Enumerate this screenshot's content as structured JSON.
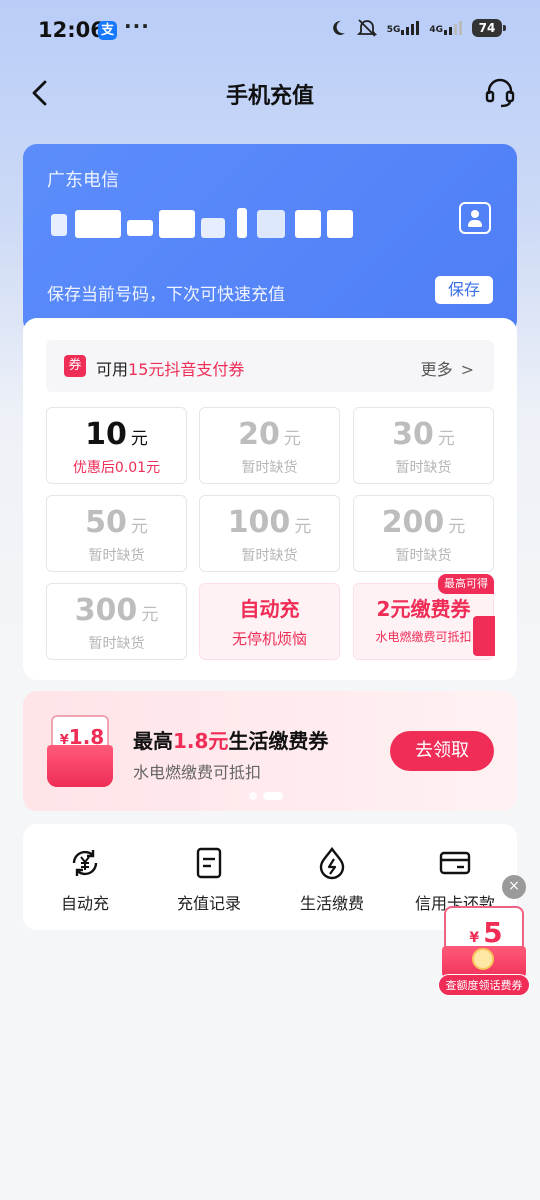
{
  "status_bar": {
    "time": "12:06",
    "app_badge": "支",
    "more": "···",
    "net_5g": "5G",
    "net_4g": "4G",
    "battery": "74"
  },
  "header": {
    "title": "手机充值"
  },
  "phone_card": {
    "carrier": "广东电信",
    "save_hint": "保存当前号码，下次可快速充值",
    "save_label": "保存"
  },
  "coupon_bar": {
    "tag": "券",
    "prefix": "可用",
    "highlight": "15元抖音支付券",
    "more": "更多"
  },
  "amounts": [
    {
      "value": "10",
      "unit": "元",
      "sub": "优惠后0.01元"
    },
    {
      "value": "20",
      "unit": "元",
      "sub": "暂时缺货"
    },
    {
      "value": "30",
      "unit": "元",
      "sub": "暂时缺货"
    },
    {
      "value": "50",
      "unit": "元",
      "sub": "暂时缺货"
    },
    {
      "value": "100",
      "unit": "元",
      "sub": "暂时缺货"
    },
    {
      "value": "200",
      "unit": "元",
      "sub": "暂时缺货"
    },
    {
      "value": "300",
      "unit": "元",
      "sub": "暂时缺货"
    }
  ],
  "promo_cells": {
    "auto": {
      "title": "自动充",
      "sub": "无停机烦恼"
    },
    "bill": {
      "badge": "最高可得",
      "title": "2元缴费券",
      "sub": "水电燃缴费可抵扣"
    }
  },
  "banner": {
    "envelope_currency": "¥",
    "envelope_amount": "1.8",
    "title_prefix": "最高",
    "title_highlight": "1.8元",
    "title_suffix": "生活缴费券",
    "subtitle": "水电燃缴费可抵扣",
    "button": "去领取"
  },
  "services": [
    {
      "label": "自动充",
      "icon": "auto-recharge-icon"
    },
    {
      "label": "充值记录",
      "icon": "record-icon"
    },
    {
      "label": "生活缴费",
      "icon": "utility-icon"
    },
    {
      "label": "信用卡还款",
      "icon": "credit-card-icon"
    }
  ],
  "float_promo": {
    "currency": "¥",
    "amount": "5",
    "label": "查额度领话费券",
    "close": "×"
  },
  "colors": {
    "accent_red": "#ef2d56",
    "card_blue": "#5c8dfb"
  }
}
